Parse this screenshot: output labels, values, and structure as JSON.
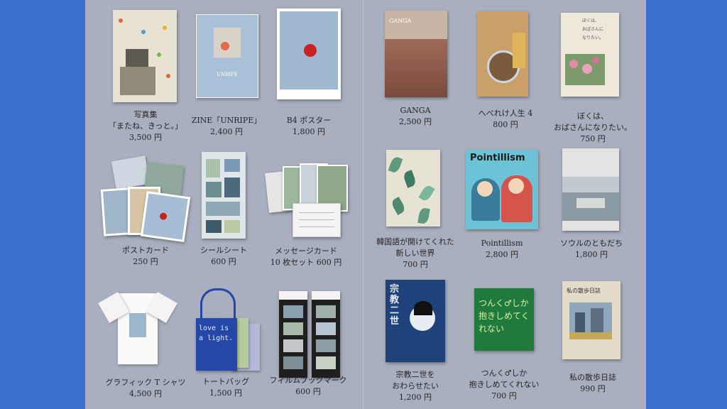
{
  "products": {
    "photobook": {
      "title_line1": "写真集",
      "title_line2": "「またね、きっと。」",
      "price": "3,500 円"
    },
    "zine": {
      "title": "ZINE「UNRIPE」",
      "price": "2,400 円",
      "cover_text": "UNRIPE"
    },
    "poster": {
      "title": "B4 ポスター",
      "price": "1,800 円"
    },
    "ganga": {
      "title": "GANGA",
      "price": "2,500 円",
      "cover_text": "GANGA"
    },
    "heberekejinsei": {
      "title": "へべれけ人生 4",
      "price": "800 円"
    },
    "bokuwa": {
      "title_line1": "ぼくは、",
      "title_line2": "おばさんになりたい。",
      "price": "750 円",
      "cover_line1": "ぼくは、",
      "cover_line2": "おばさんに",
      "cover_line3": "なりたい。"
    },
    "postcard": {
      "title": "ポストカード",
      "price": "250 円"
    },
    "sticker": {
      "title": "シールシート",
      "price": "600 円"
    },
    "messagecard": {
      "title_line1": "メッセージカード",
      "title_line2": "10 枚セット 600 円"
    },
    "korean": {
      "title_line1": "韓国語が開けてくれた",
      "title_line2": "新しい世界",
      "price": "700 円"
    },
    "pointillism": {
      "title": "Pointillism",
      "price": "2,800 円",
      "cover_text": "Pointillism"
    },
    "seoul": {
      "title": "ソウルのともだち",
      "price": "1,800 円"
    },
    "tshirt": {
      "title": "グラフィック T シャツ",
      "price": "4,500 円"
    },
    "totebag": {
      "title": "トートバッグ",
      "price": "1,500 円",
      "bag_text": "love is a light."
    },
    "bookmark": {
      "title": "フィルムブックマーク",
      "price": "600 円"
    },
    "shukyo": {
      "title_line1": "宗教二世を",
      "title_line2": "おわらせたい",
      "price": "1,200 円",
      "cover_text": "宗教二世"
    },
    "tsunku": {
      "title_line1": "つんく♂しか",
      "title_line2": "抱きしめてくれない",
      "price": "700 円",
      "cover_text": "つんく♂しか抱きしめてくれない"
    },
    "sanpo": {
      "title": "私の散歩日誌",
      "price": "990 円",
      "cover_text": "私の散歩日誌"
    }
  },
  "colors": {
    "background": "#3a6fd0",
    "panel": "#a9afbf",
    "text": "#25262b"
  }
}
